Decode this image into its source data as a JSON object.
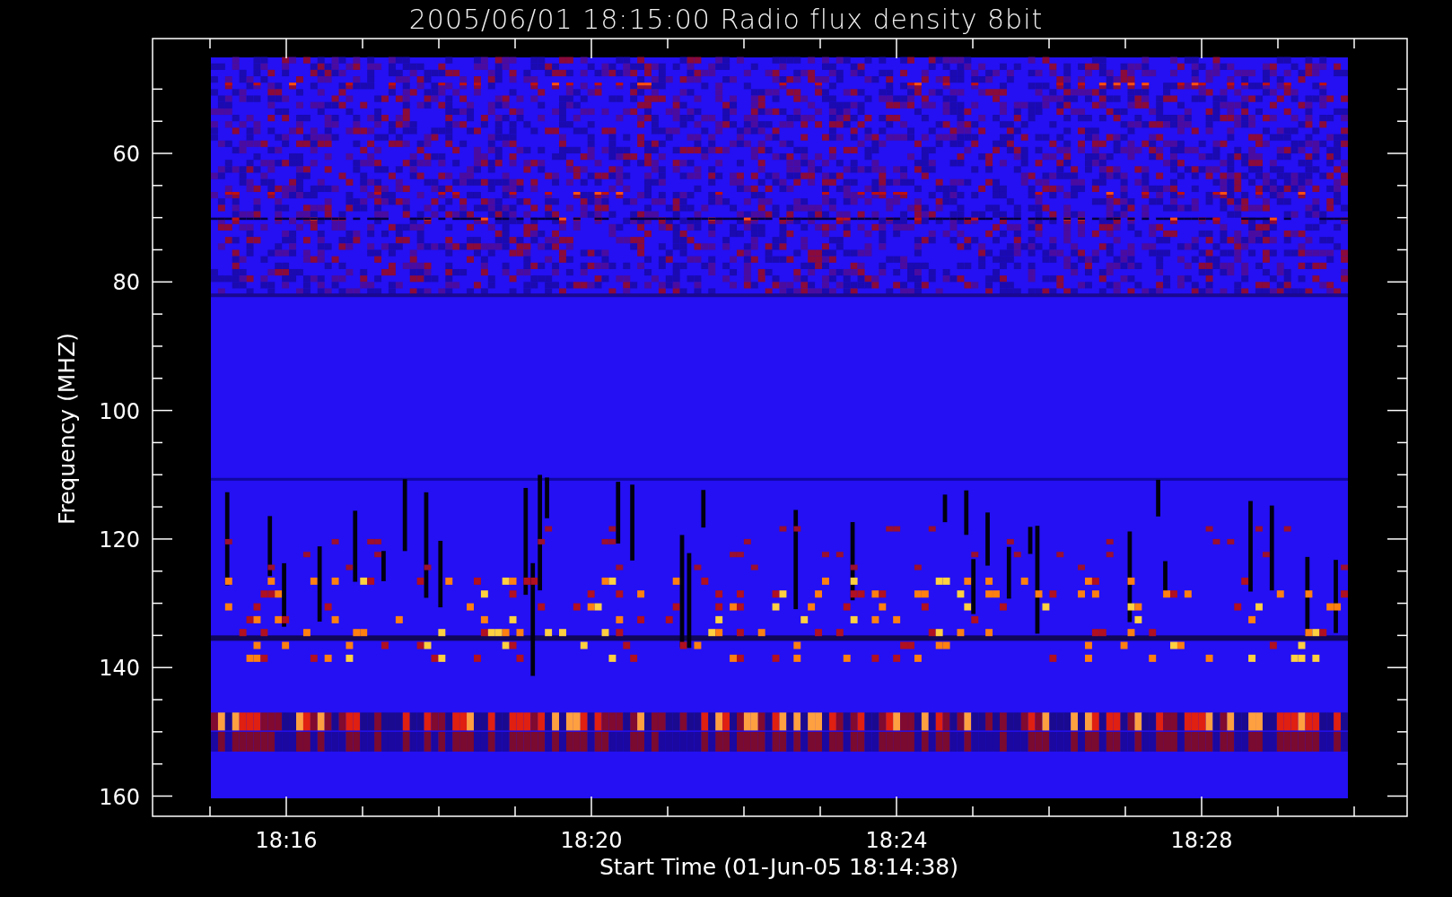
{
  "title": "2005/06/01 18:15:00 Radio flux density 8bit",
  "plot": {
    "xlabel": "Start Time (01-Jun-05 18:14:38)",
    "ylabel": "Frequency (MHZ)",
    "yticks": [
      "60",
      "80",
      "100",
      "120",
      "140",
      "160"
    ],
    "xticks": [
      "18:16",
      "18:20",
      "18:24",
      "18:28"
    ]
  }
}
